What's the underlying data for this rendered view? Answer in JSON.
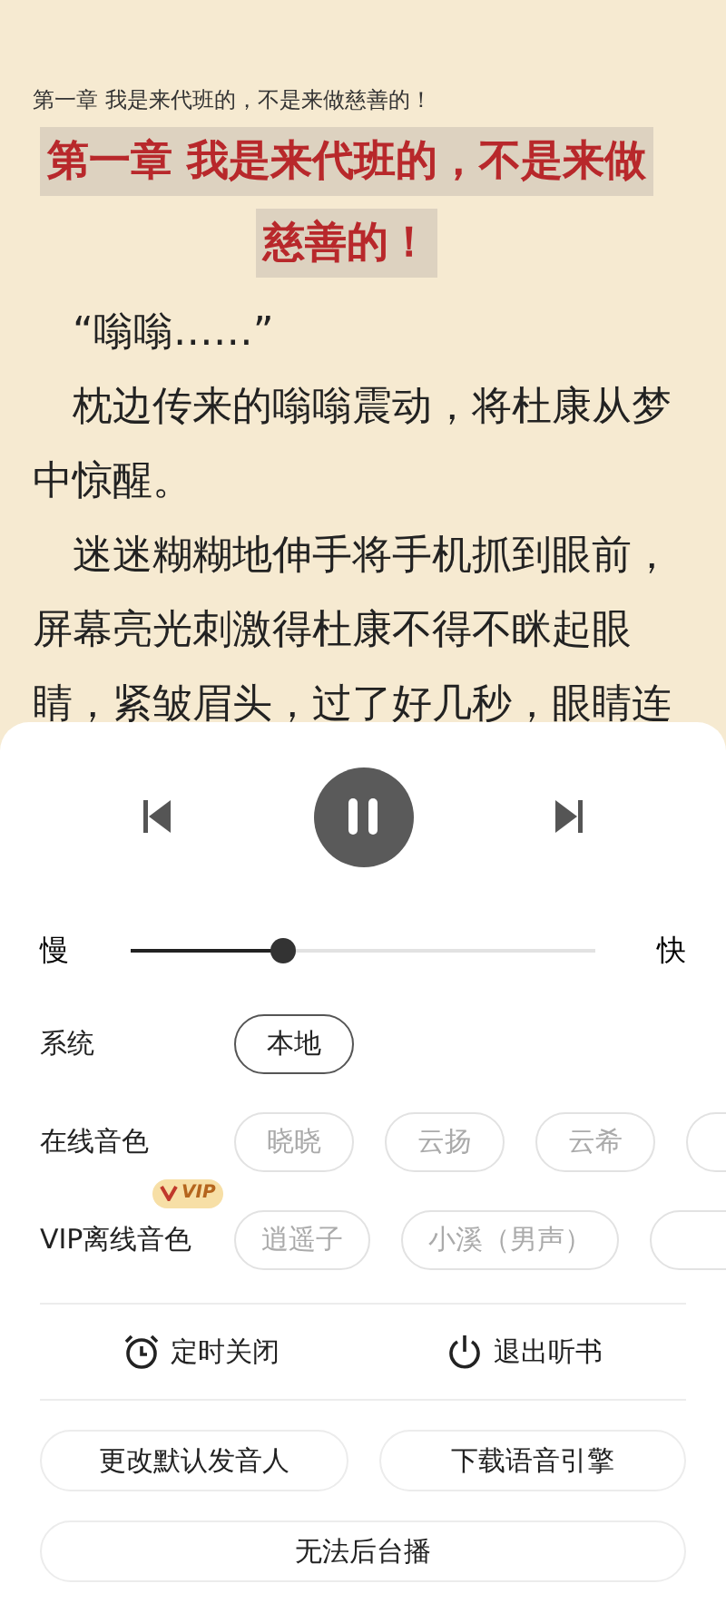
{
  "reader": {
    "header": "第一章 我是来代班的，不是来做慈善的！",
    "chapter_title": [
      "第一章 我是来代班的，不是来做",
      "慈善的！"
    ],
    "paragraphs": [
      "“嗡嗡……”",
      "枕边传来的嗡嗡震动，将杜康从梦中惊醒。",
      "迷迷糊糊地伸手将手机抓到眼前，屏幕亮光刺激得杜康不得不眯起眼睛，紧皱眉头，过了好几秒，眼睛连"
    ]
  },
  "player": {
    "playing": true,
    "speed": {
      "slow_label": "慢",
      "fast_label": "快",
      "level": 0.33
    },
    "voice_groups": [
      {
        "label": "系统",
        "voices": [
          {
            "name": "本地",
            "selected": true
          }
        ]
      },
      {
        "label": "在线音色",
        "voices": [
          {
            "name": "晓晓",
            "selected": false
          },
          {
            "name": "云扬",
            "selected": false
          },
          {
            "name": "云希",
            "selected": false
          },
          {
            "selected": false
          }
        ]
      },
      {
        "label": "VIP离线音色",
        "badge": "VIP",
        "voices": [
          {
            "name": "逍遥子",
            "selected": false
          },
          {
            "name": "小溪（男声）",
            "selected": false
          },
          {
            "selected": false
          }
        ]
      }
    ],
    "actions": [
      {
        "kind": "timer",
        "label": "定时关闭"
      },
      {
        "kind": "exit",
        "label": "退出听书"
      }
    ],
    "buttons": [
      {
        "label": "更改默认发音人"
      },
      {
        "label": "下载语音引擎"
      },
      {
        "label": "无法后台播"
      }
    ]
  }
}
